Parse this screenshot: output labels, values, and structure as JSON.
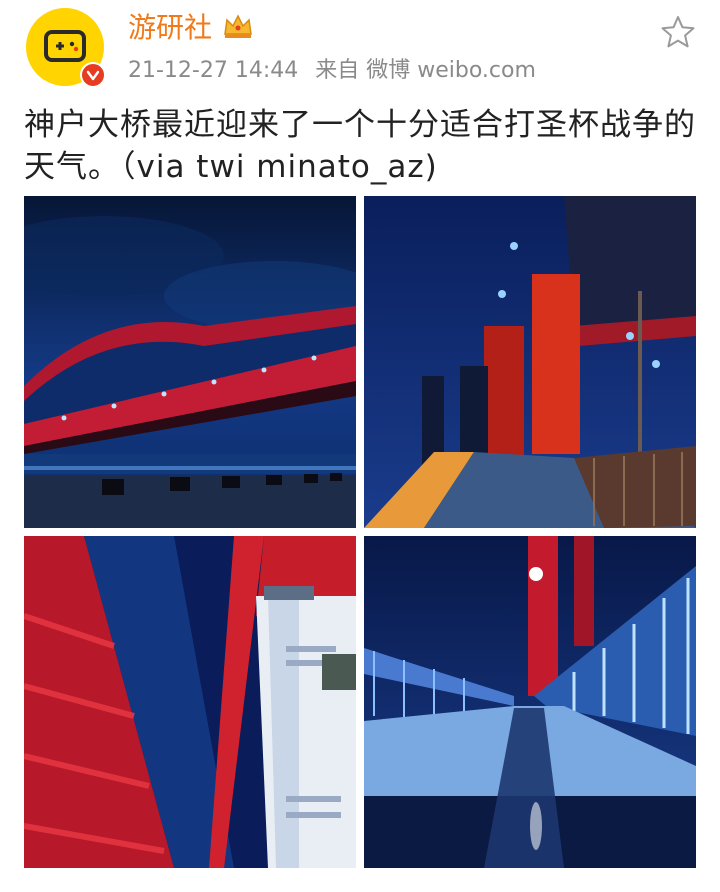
{
  "post": {
    "username": "游研社",
    "timestamp": "21-12-27 14:44",
    "source": "来自 微博 weibo.com",
    "text": "神户大桥最近迎来了一个十分适合打圣杯战争的天气。（via twi minato_az)"
  },
  "icons": {
    "avatar": "game-controller-logo",
    "verified": "verified-badge-icon",
    "vip": "crown-icon",
    "follow": "star-icon"
  },
  "colors": {
    "username": "#f07a1a",
    "avatar_bg": "#ffd400",
    "verified_badge": "#e63c22",
    "meta_text": "#8a8a8a",
    "body_text": "#222222"
  }
}
